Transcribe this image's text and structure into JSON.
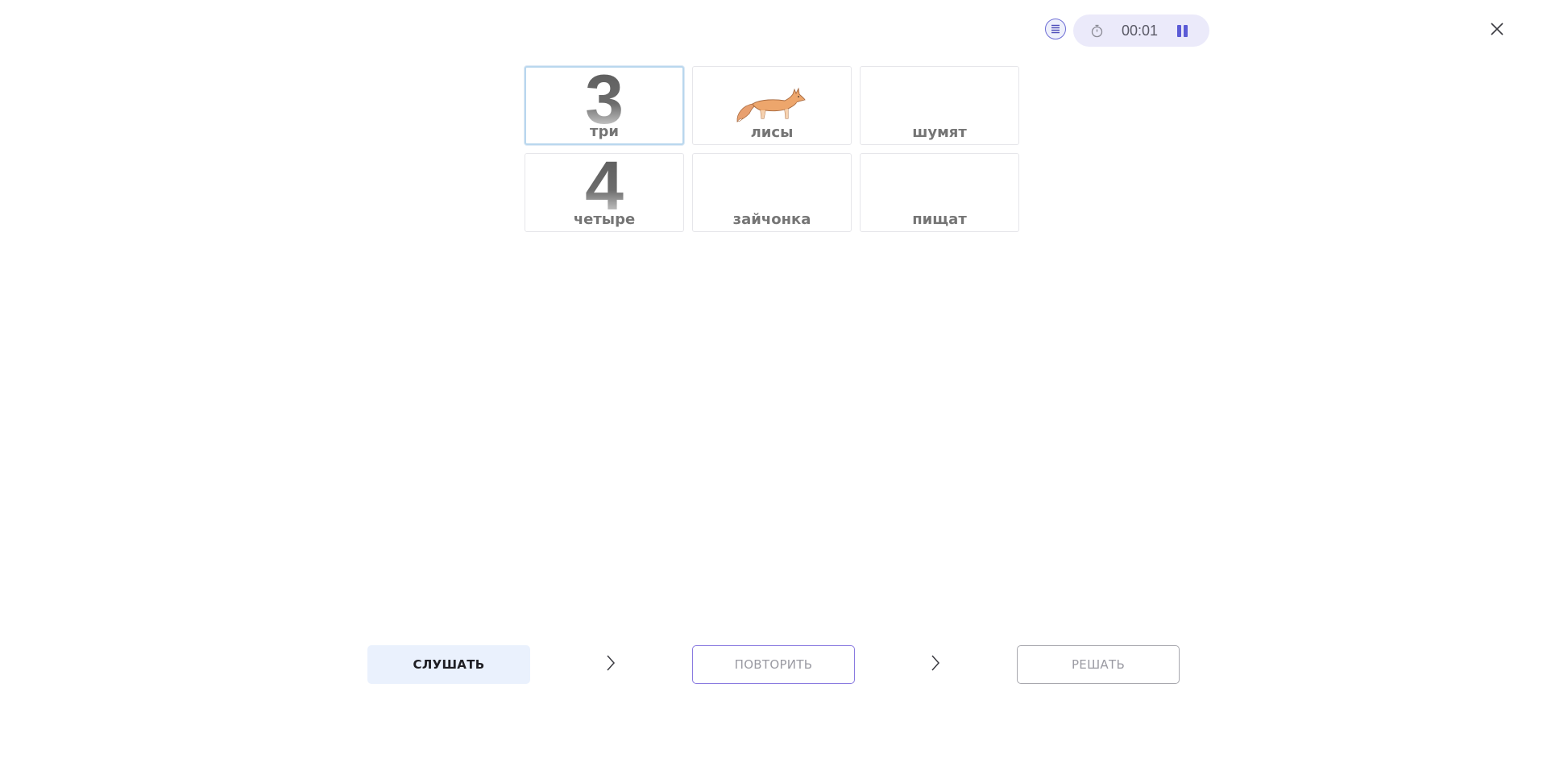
{
  "header": {
    "menu_icon": "list-icon",
    "timer": {
      "icon": "stopwatch-icon",
      "value": "00:01",
      "pause_icon": "pause-icon"
    },
    "close_icon": "close-icon"
  },
  "cards": [
    {
      "label": "три",
      "digit": "3",
      "selected": true
    },
    {
      "label": "лисы",
      "image": "fox",
      "selected": false
    },
    {
      "label": "шумят",
      "selected": false
    },
    {
      "label": "четыре",
      "digit": "4",
      "selected": false
    },
    {
      "label": "зайчонка",
      "selected": false
    },
    {
      "label": "пищат",
      "selected": false
    }
  ],
  "actions": {
    "listen_label": "СЛУШАТЬ",
    "repeat_label": "ПОВТОРИТЬ",
    "solve_label": "РЕШАТЬ"
  },
  "colors": {
    "accent": "#6f6fd6",
    "timer_bg": "#ebeafa",
    "listen_bg": "#eaf1fd",
    "selected_border": "#b9d7ee"
  }
}
